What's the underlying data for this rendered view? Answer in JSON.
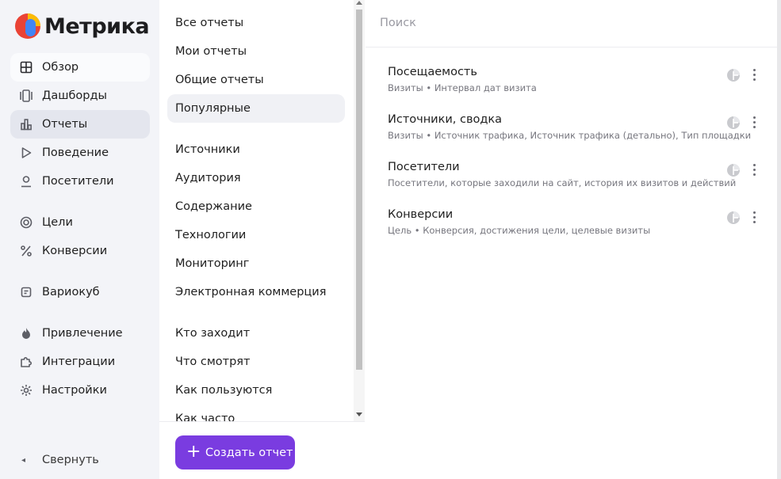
{
  "app": {
    "logo_text": "Метрика"
  },
  "sidebar": {
    "items": [
      {
        "label": "Обзор",
        "icon": "grid-icon"
      },
      {
        "label": "Дашборды",
        "icon": "dashboards-icon"
      },
      {
        "label": "Отчеты",
        "icon": "bar-chart-icon"
      },
      {
        "label": "Поведение",
        "icon": "play-icon"
      },
      {
        "label": "Посетители",
        "icon": "user-icon"
      },
      {
        "label": "Цели",
        "icon": "target-icon"
      },
      {
        "label": "Конверсии",
        "icon": "percent-icon"
      },
      {
        "label": "Вариокуб",
        "icon": "variocube-icon"
      },
      {
        "label": "Привлечение",
        "icon": "flame-icon"
      },
      {
        "label": "Интеграции",
        "icon": "puzzle-icon"
      },
      {
        "label": "Настройки",
        "icon": "gear-icon"
      }
    ],
    "collapse_label": "Свернуть"
  },
  "categories": {
    "items": [
      "Все отчеты",
      "Мои отчеты",
      "Общие отчеты",
      "Популярные",
      "Источники",
      "Аудитория",
      "Содержание",
      "Технологии",
      "Мониторинг",
      "Электронная коммерция",
      "Кто заходит",
      "Что смотрят",
      "Как пользуются",
      "Как часто"
    ],
    "selected": "Популярные",
    "create_button_label": "Создать отчет"
  },
  "search": {
    "placeholder": "Поиск",
    "value": ""
  },
  "reports": [
    {
      "title": "Посещаемость",
      "description": "Визиты • Интервал дат визита"
    },
    {
      "title": "Источники, сводка",
      "description": "Визиты • Источник трафика, Источник трафика (детально), Тип площадки"
    },
    {
      "title": "Посетители",
      "description": "Посетители, которые заходили на сайт, история их визитов и действий"
    },
    {
      "title": "Конверсии",
      "description": "Цель • Конверсия, достижения цели, целевые визиты"
    }
  ],
  "colors": {
    "accent": "#7a3ce0",
    "sidebar_bg": "#f3f4f8",
    "logo_red": "#ea4335",
    "logo_yellow": "#fbbc05",
    "logo_blue": "#4285f4"
  }
}
